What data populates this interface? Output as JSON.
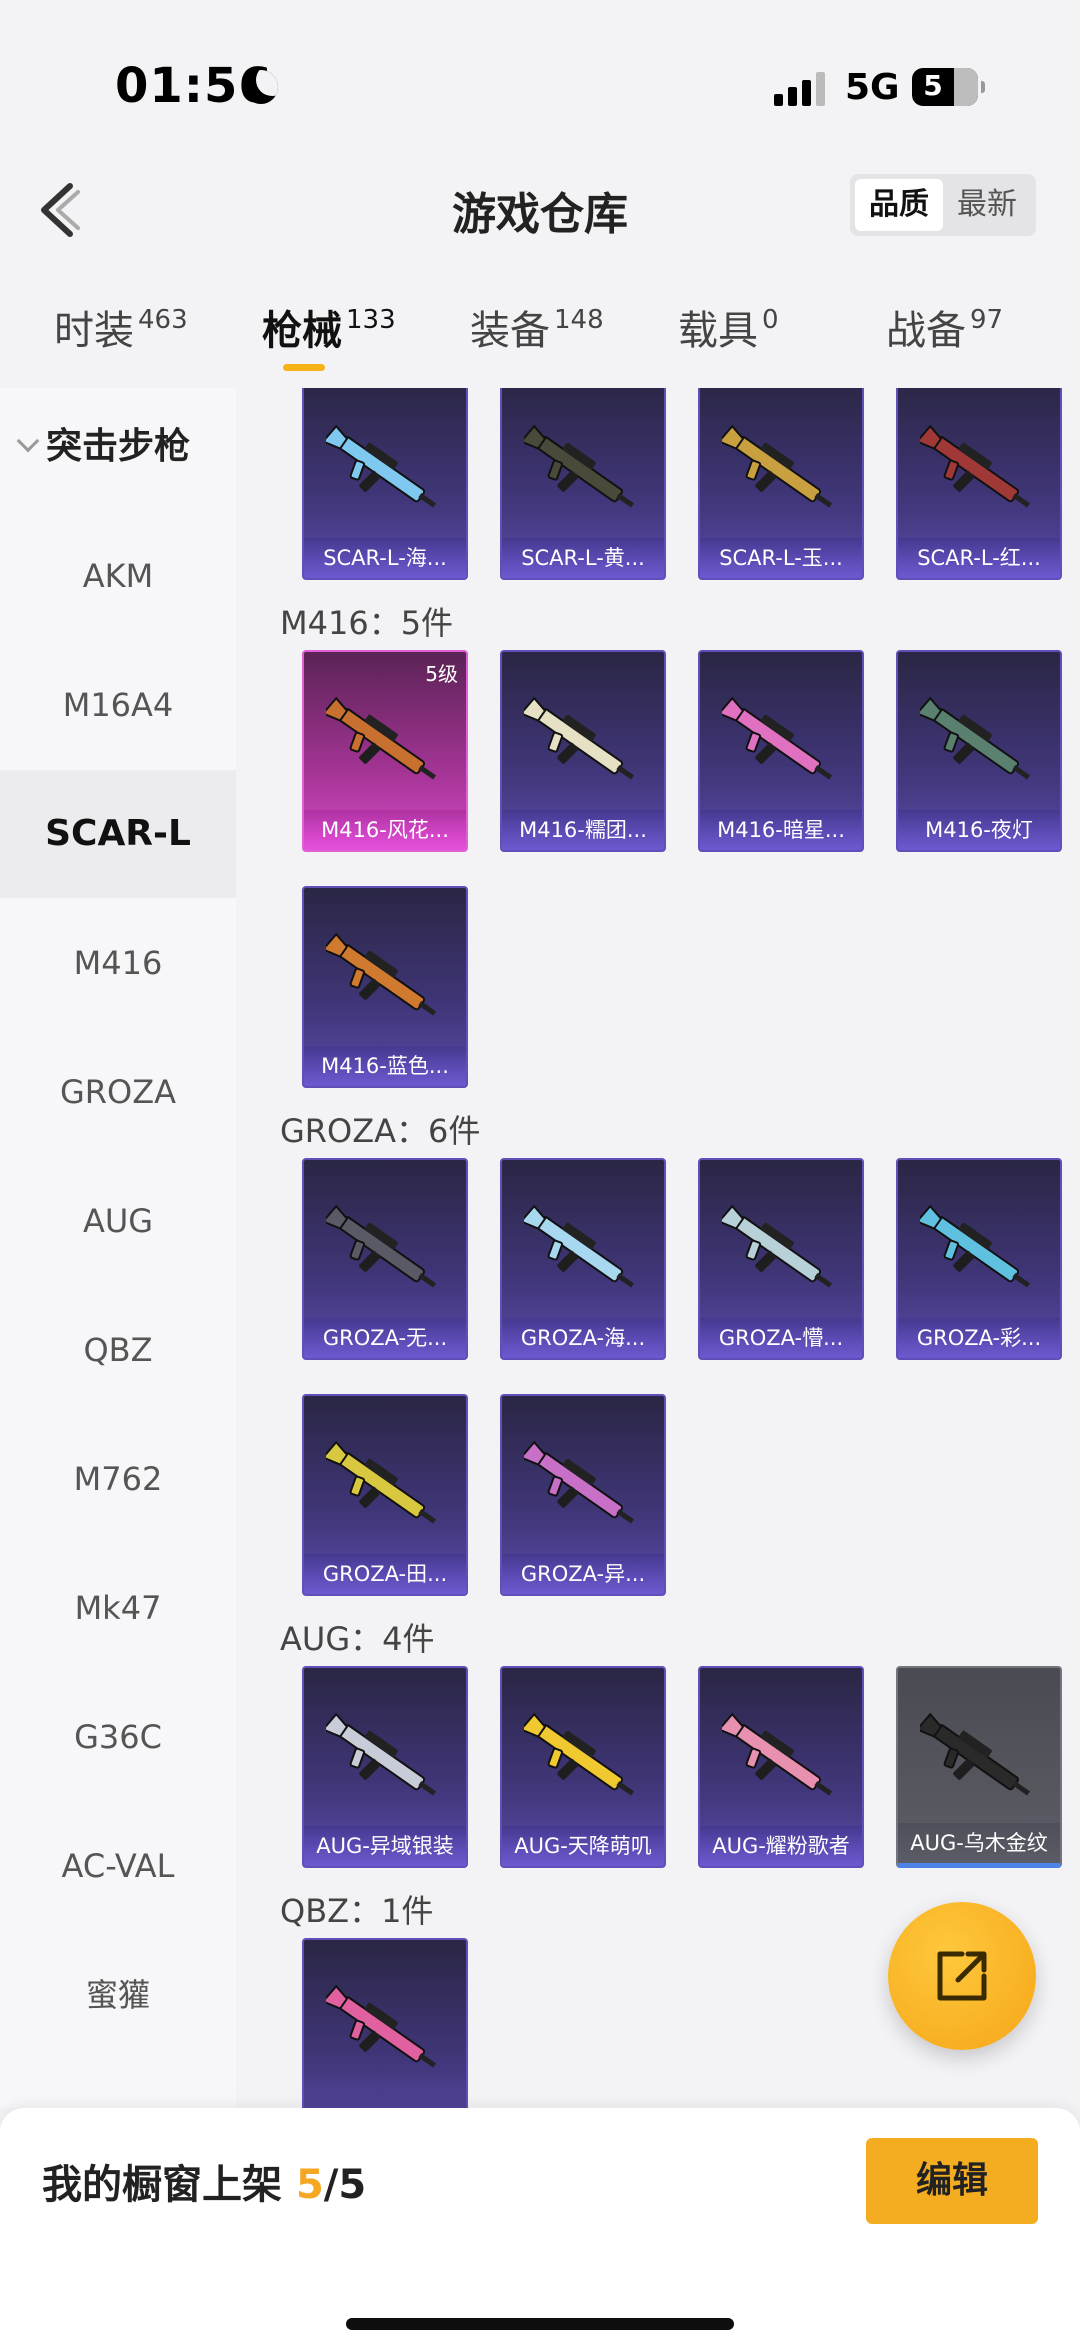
{
  "status": {
    "time": "01:56",
    "network": "5G",
    "battery": "5"
  },
  "header": {
    "title": "游戏仓库",
    "sort_options": [
      "品质",
      "最新"
    ]
  },
  "tabs": [
    {
      "label": "时装",
      "count": "463"
    },
    {
      "label": "枪械",
      "count": "133"
    },
    {
      "label": "装备",
      "count": "148"
    },
    {
      "label": "载具",
      "count": "0"
    },
    {
      "label": "战备",
      "count": "97"
    }
  ],
  "sidebar": {
    "group": "突击步枪",
    "items": [
      "AKM",
      "M16A4",
      "SCAR-L",
      "M416",
      "GROZA",
      "AUG",
      "QBZ",
      "M762",
      "Mk47",
      "G36C",
      "AC-VAL",
      "蜜獾"
    ],
    "selected": "SCAR-L"
  },
  "sections": [
    {
      "label": "",
      "cards": [
        {
          "name": "SCAR-L-海...",
          "gun_color": "#7fc8f0"
        },
        {
          "name": "SCAR-L-黄...",
          "gun_color": "#4a4a3a"
        },
        {
          "name": "SCAR-L-玉...",
          "gun_color": "#c8a040"
        },
        {
          "name": "SCAR-L-红...",
          "gun_color": "#a03838"
        }
      ]
    },
    {
      "label": "M416：5件",
      "cards": [
        {
          "name": "M416-风花...",
          "gun_color": "#c87030",
          "level": "5级",
          "style": "legend"
        },
        {
          "name": "M416-糯团...",
          "gun_color": "#e6e0c4"
        },
        {
          "name": "M416-暗星...",
          "gun_color": "#e070c0"
        },
        {
          "name": "M416-夜灯",
          "gun_color": "#5a8070"
        },
        {
          "name": "M416-蓝色...",
          "gun_color": "#d07a30"
        }
      ]
    },
    {
      "label": "GROZA：6件",
      "cards": [
        {
          "name": "GROZA-无...",
          "gun_color": "#5a5a66"
        },
        {
          "name": "GROZA-海...",
          "gun_color": "#a8d8f0"
        },
        {
          "name": "GROZA-懵...",
          "gun_color": "#b8d0d8"
        },
        {
          "name": "GROZA-彩...",
          "gun_color": "#60c0e0"
        },
        {
          "name": "GROZA-田...",
          "gun_color": "#d8c840"
        },
        {
          "name": "GROZA-异...",
          "gun_color": "#c870c8"
        }
      ]
    },
    {
      "label": "AUG：4件",
      "cards": [
        {
          "name": "AUG-异域银装",
          "gun_color": "#c8ccd8"
        },
        {
          "name": "AUG-天降萌叽",
          "gun_color": "#f0c830"
        },
        {
          "name": "AUG-耀粉歌者",
          "gun_color": "#e890b0"
        },
        {
          "name": "AUG-乌木金纹",
          "gun_color": "#2a2a2a",
          "style": "grey"
        }
      ]
    },
    {
      "label": "QBZ：1件",
      "cards": [
        {
          "name": "",
          "gun_color": "#e060a0"
        }
      ]
    }
  ],
  "showcase": {
    "label": "我的橱窗上架 ",
    "count": "5",
    "total": "/5"
  },
  "buttons": {
    "edit": "编辑"
  },
  "colors": {
    "accent": "#f4ad21",
    "card_epic": "#403679",
    "card_legend": "#a33494"
  }
}
